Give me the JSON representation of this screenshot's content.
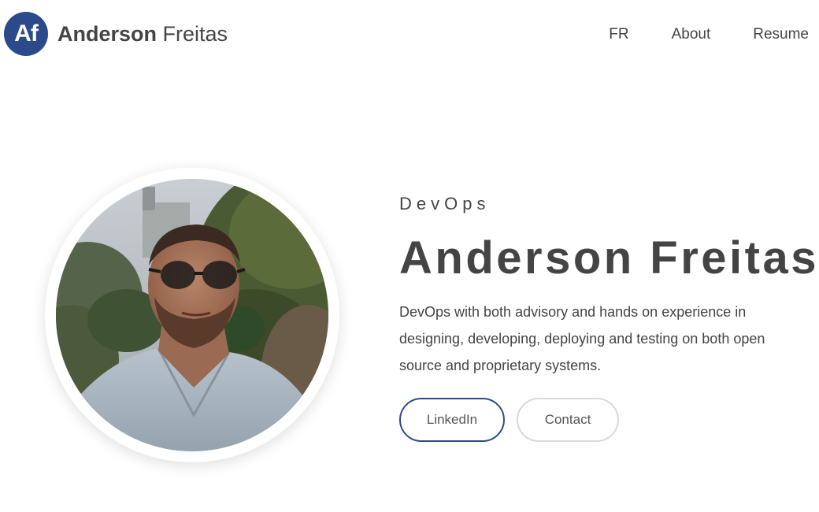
{
  "header": {
    "logo_text": "Af",
    "brand_first": "Anderson",
    "brand_last": "Freitas",
    "nav": [
      {
        "label": "FR"
      },
      {
        "label": "About"
      },
      {
        "label": "Resume"
      }
    ]
  },
  "hero": {
    "eyebrow": "DevOps",
    "title": "Anderson Freitas",
    "description": "DevOps with both advisory and hands on experience in designing, developing, deploying and testing on both open source and proprietary systems.",
    "buttons": {
      "linkedin": "LinkedIn",
      "contact": "Contact"
    }
  },
  "colors": {
    "brand": "#2b4a8b",
    "text": "#444444",
    "button_border_secondary": "#d8d8d8"
  },
  "icons": {
    "logo": "af-monogram-logo",
    "portrait": "profile-photo"
  }
}
